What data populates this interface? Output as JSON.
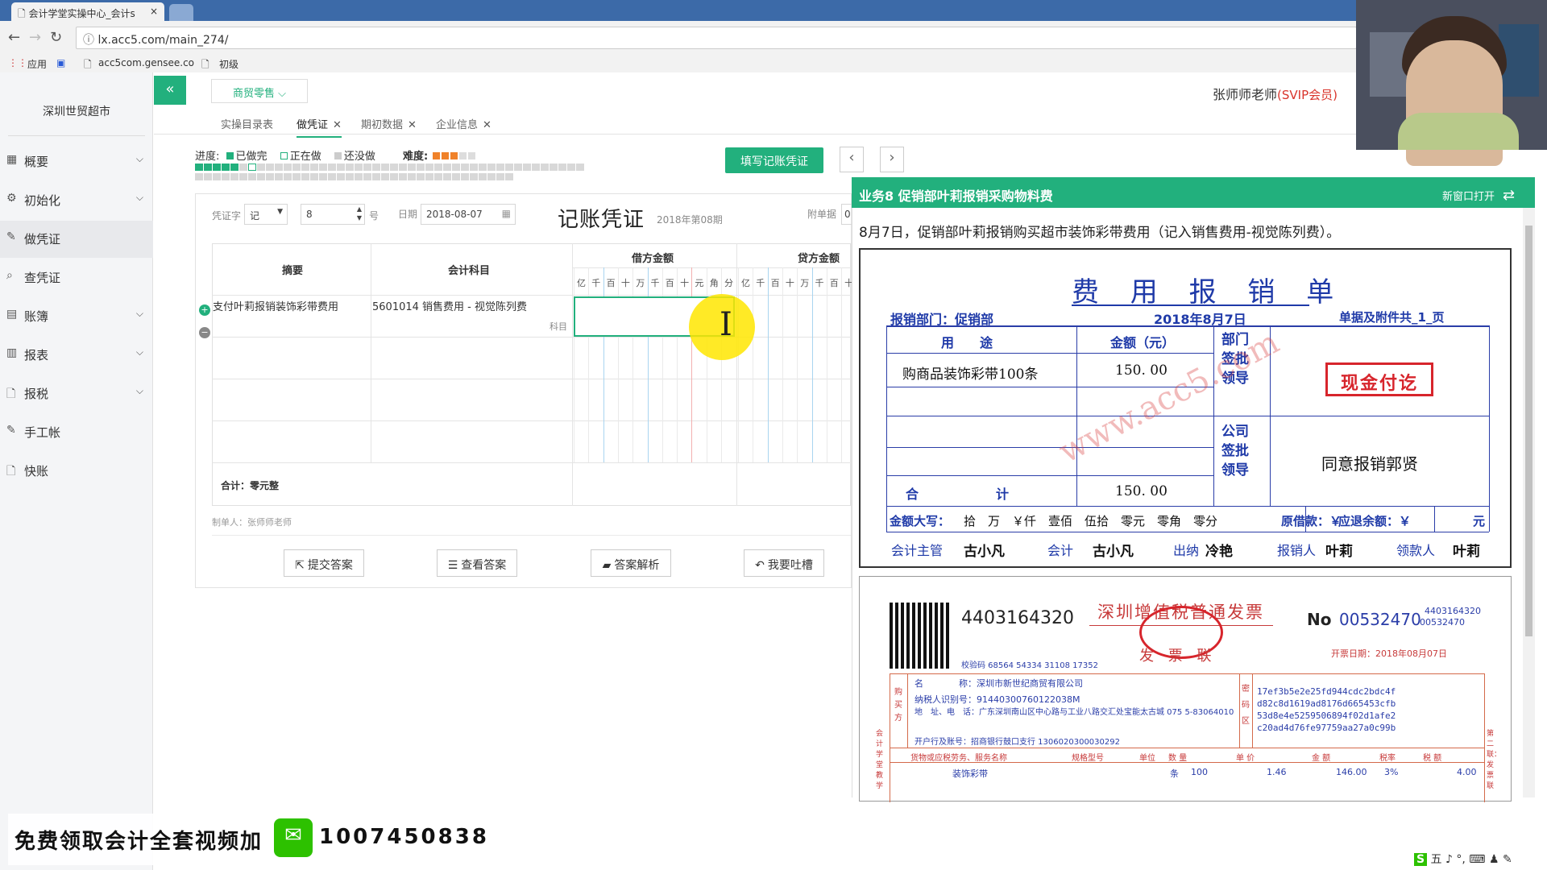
{
  "browser": {
    "tab_title": "会计学堂实操中心_会计s",
    "tab_close": "×",
    "url": "lx.acc5.com/main_274/",
    "bookmarks": [
      "应用",
      "acc5com.gensee.co",
      "初级"
    ]
  },
  "sidebar": {
    "company": "深圳世贸超市",
    "items": [
      {
        "label": "概要",
        "icon": "grid-icon",
        "has_children": true
      },
      {
        "label": "初始化",
        "icon": "gear-icon",
        "has_children": true
      },
      {
        "label": "做凭证",
        "icon": "pen-icon",
        "has_children": false,
        "active": true
      },
      {
        "label": "查凭证",
        "icon": "search-icon",
        "has_children": false
      },
      {
        "label": "账簿",
        "icon": "book-icon",
        "has_children": true
      },
      {
        "label": "报表",
        "icon": "report-icon",
        "has_children": true
      },
      {
        "label": "报税",
        "icon": "file-icon",
        "has_children": true
      },
      {
        "label": "手工帐",
        "icon": "pen-icon",
        "has_children": false
      },
      {
        "label": "快账",
        "icon": "file-icon",
        "has_children": false
      }
    ]
  },
  "topbar": {
    "collapse": "«",
    "industry": "商贸零售 ⌵",
    "teacher": "张师师老师",
    "vip": "(SVIP会员)"
  },
  "subtabs": [
    {
      "label": "实操目录表",
      "closable": false
    },
    {
      "label": "做凭证",
      "closable": true,
      "active": true
    },
    {
      "label": "期初数据",
      "closable": true
    },
    {
      "label": "企业信息",
      "closable": true
    }
  ],
  "progress": {
    "label": "进度:",
    "done": "已做完",
    "doing": "正在做",
    "todo": "还没做",
    "difficulty_label": "难度:",
    "difficulty_stars": 3,
    "difficulty_max": 5,
    "done_count": 5,
    "doing_index": 6,
    "total": 80
  },
  "fill_button": "填写记账凭证",
  "prev_arrow": "‹",
  "next_arrow": "›",
  "voucher": {
    "type_label": "凭证字",
    "type_value": "记",
    "number": "8",
    "number_suffix": "号",
    "date_label": "日期",
    "date": "2018-08-07",
    "title": "记账凭证",
    "period": "2018年第08期",
    "attach_label": "附单据",
    "attach_value": "0",
    "headers": {
      "summary": "摘要",
      "account": "会计科目",
      "debit": "借方金额",
      "credit": "贷方金额"
    },
    "digit_units": [
      "亿",
      "千",
      "百",
      "十",
      "万",
      "千",
      "百",
      "十",
      "元",
      "角",
      "分"
    ],
    "credit_digit_units": [
      "亿",
      "千",
      "百",
      "十",
      "万",
      "千",
      "百",
      "十"
    ],
    "rows": [
      {
        "summary": "支付叶莉报销装饰彩带费用",
        "account": "5601014 销售费用 - 视觉陈列费",
        "account_hint": "科目"
      }
    ],
    "total_label": "合计：零元整",
    "maker": "制单人：张师师老师"
  },
  "actions": [
    {
      "label": "提交答案",
      "icon": "share-icon"
    },
    {
      "label": "查看答案",
      "icon": "list-icon"
    },
    {
      "label": "答案解析",
      "icon": "folder-icon"
    },
    {
      "label": "我要吐槽",
      "icon": "reply-icon"
    }
  ],
  "task": {
    "title": "业务8 促销部叶莉报销采购物料费",
    "new_window": "新窗口打开",
    "description": "8月7日，促销部叶莉报销购买超市装饰彩带费用（记入销售费用-视觉陈列费）。"
  },
  "expense_form": {
    "title": "费 用 报 销 单",
    "dept": "报销部门：促销部",
    "date": "2018年8月7日",
    "attachments": "单据及附件共_1_页",
    "col_use": "用　　途",
    "col_amount": "金额（元）",
    "dept_sign": "部门签批领导",
    "item": "购商品装饰彩带100条",
    "item_amount": "150. 00",
    "stamp": "现金付讫",
    "company_sign": "公司签批领导",
    "approval": "同意报销郭贤",
    "total_label": "合　　　　　　计",
    "total_amount": "150. 00",
    "amount_words_label": "金额大写：",
    "amount_words": "拾　万　￥仟　壹佰　伍拾　零元　零角　零分",
    "borrow": "原借款：￥",
    "refund": "应退余额：￥",
    "refund_unit": "元",
    "signers": [
      {
        "role": "会计主管",
        "name": "古小凡"
      },
      {
        "role": "会计",
        "name": "古小凡"
      },
      {
        "role": "出纳",
        "name": "冷艳"
      },
      {
        "role": "报销人",
        "name": "叶莉"
      },
      {
        "role": "领款人",
        "name": "叶莉"
      }
    ],
    "watermark": "www.acc5.com"
  },
  "invoice": {
    "code": "4403164320",
    "title": "深圳增值税普通发票",
    "subtitle": "发 票 联",
    "no_label": "No",
    "number": "00532470",
    "code_small": "4403164320",
    "number_small": "00532470",
    "issue_date": "开票日期：2018年08月07日",
    "check_code": "校验码 68564 54334 31108 17352",
    "buyer_name": "名　　　　称：深圳市新世纪商贸有限公司",
    "buyer_tax": "纳税人识别号：91440300760122038M",
    "buyer_addr": "地　址、电　话：广东深圳南山区中心路与工业八路交汇处宝能太古城 075 5-83064010",
    "buyer_bank": "开户行及账号：招商银行鼓口支行 1306020300030292",
    "cipher": [
      "17ef3b5e2e25fd944cdc2bdc4f",
      "d82c8d1619ad8176d665453cfb",
      "53d8e4e5259506894f02d1afe2",
      "c20ad4d76fe97759aa27a0c99b"
    ],
    "side_buyer": "购买方",
    "side_cipher": "密码区",
    "item_headers": [
      "货物或应税劳务、服务名称",
      "规格型号",
      "单位",
      "数 量",
      "单 价",
      "金 额",
      "税率",
      "税 额"
    ],
    "item": {
      "name": "装饰彩带",
      "unit": "条",
      "qty": "100",
      "price": "1.46",
      "amount": "146.00",
      "rate": "3%",
      "tax": "4.00"
    },
    "left_vertical": "会计学堂教学",
    "right_vertical": "第二联：发票联"
  },
  "promo": {
    "text": "免费领取会计全套视频加",
    "number": "1007450838"
  },
  "ime": "五 ♪ °, ⌨ ♟ ✎"
}
